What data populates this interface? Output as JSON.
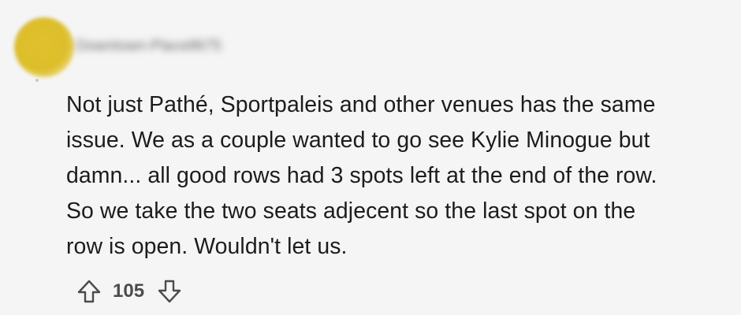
{
  "comment": {
    "author": "Downtown-Place8675",
    "body_lines": [
      "Not just Pathé, Sportpaleis and other venues has the same",
      "issue. We as a couple wanted to go see Kylie Minogue but",
      "damn... all good rows had 3 spots left at the end of the row.",
      "So we take the two seats adjecent so the last spot on the",
      "row is open. Wouldn't let us."
    ],
    "vote_count": "105"
  },
  "icons": {
    "upvote": "arrow-up-outline-icon",
    "downvote": "arrow-down-outline-icon"
  },
  "colors": {
    "background": "#f5f5f5",
    "text": "#1c1c1c",
    "avatar": "#dcbd2a",
    "vote_count": "#4b4b4b"
  }
}
